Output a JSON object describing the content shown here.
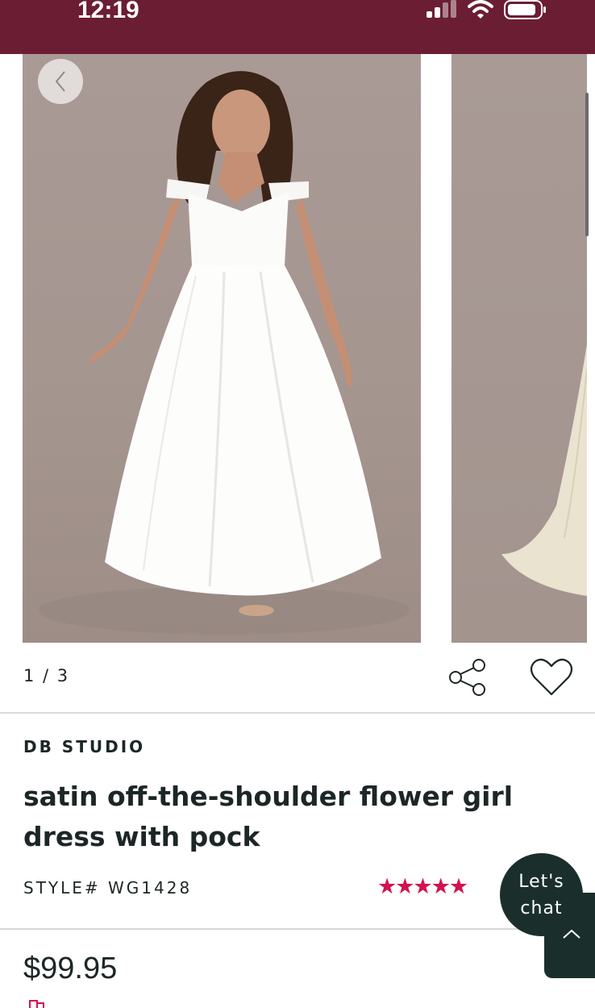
{
  "status_bar": {
    "time": "12:19"
  },
  "gallery": {
    "counter": "1 / 3",
    "image_count": 3,
    "current_image": 1
  },
  "product": {
    "brand": "DB STUDIO",
    "title": "satin off-the-shoulder flower girl dress with pock",
    "style_number": "STYLE# WG1428",
    "rating_stars": "★★★★★",
    "rating_value": 5,
    "price": "$99.95"
  },
  "chat": {
    "line1": "Let's",
    "line2": "chat"
  },
  "colors": {
    "status_bar": "#6b1d34",
    "star": "#d3124f",
    "chat": "#1a2f2c",
    "text": "#1d2626"
  },
  "icons": [
    "chevron-left-icon",
    "share-icon",
    "heart-icon",
    "chevron-up-icon",
    "signal-icon",
    "wifi-icon",
    "battery-icon"
  ]
}
